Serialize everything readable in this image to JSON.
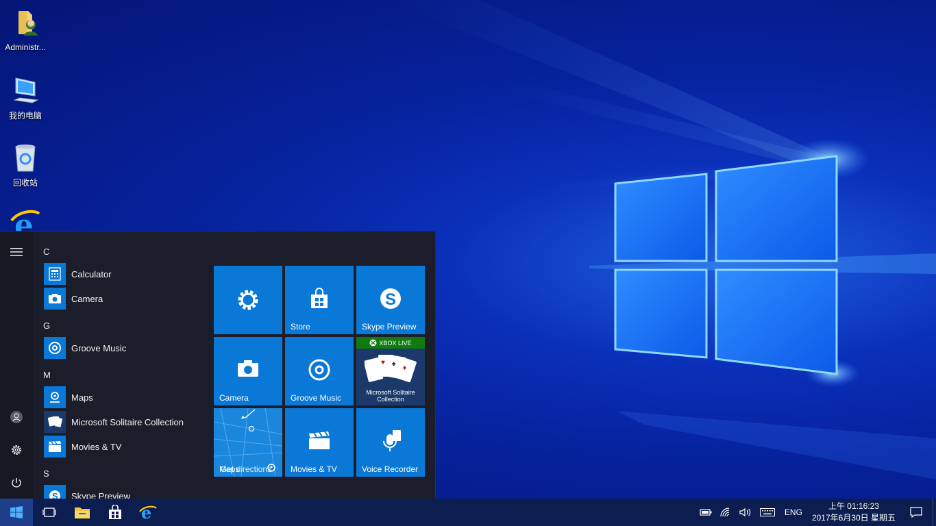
{
  "desktop": {
    "icons": [
      {
        "label": "Administr..."
      },
      {
        "label": "我的电脑"
      },
      {
        "label": "回收站"
      }
    ]
  },
  "start_menu": {
    "groups": [
      {
        "letter": "C",
        "apps": [
          "Calculator",
          "Camera"
        ]
      },
      {
        "letter": "G",
        "apps": [
          "Groove Music"
        ]
      },
      {
        "letter": "M",
        "apps": [
          "Maps",
          "Microsoft Solitaire Collection",
          "Movies & TV"
        ]
      },
      {
        "letter": "S",
        "apps": [
          "Skype Preview"
        ]
      }
    ],
    "tiles": [
      {
        "label": ""
      },
      {
        "label": "Store"
      },
      {
        "label": "Skype Preview"
      },
      {
        "label": "Camera"
      },
      {
        "label": "Groove Music"
      },
      {
        "label": "Microsoft Solitaire Collection",
        "badge": "XBOX LIVE"
      },
      {
        "label": "Maps",
        "overlay": "Get directions"
      },
      {
        "label": "Movies & TV"
      },
      {
        "label": "Voice Recorder"
      }
    ]
  },
  "taskbar": {
    "language": "ENG",
    "time": "上午 01:16:23",
    "date": "2017年6月30日 星期五"
  },
  "colors": {
    "tile": "#0a78d7",
    "xbox_green": "#107c10",
    "taskbar": "#0c1d4f",
    "start_bg": "#1c1d2a"
  }
}
